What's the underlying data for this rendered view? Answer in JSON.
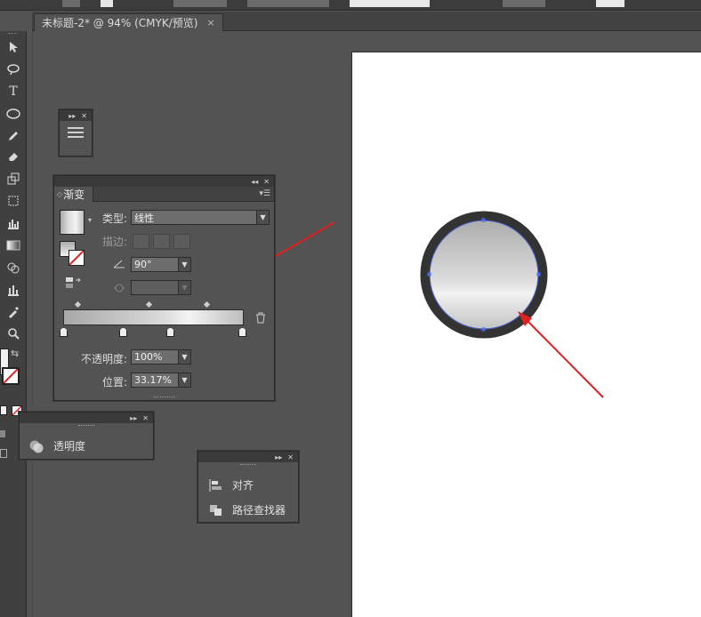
{
  "document_tab": {
    "title": "未标题-2* @ 94% (CMYK/预览)",
    "close": "×"
  },
  "gradient_panel": {
    "tab_label": "渐变",
    "type_label": "类型:",
    "type_value": "线性",
    "stroke_label": "描边:",
    "angle_value": "90°",
    "opacity_label": "不透明度:",
    "opacity_value": "100%",
    "location_label": "位置:",
    "location_value": "33.17%"
  },
  "transparency_panel": {
    "label": "透明度"
  },
  "align_panel": {
    "items": [
      {
        "label": "对齐",
        "icon": "align-icon"
      },
      {
        "label": "路径查找器",
        "icon": "pathfinder-icon"
      }
    ]
  },
  "colors": {
    "accent_arrow": "#e02020",
    "circle_stroke": "#333333",
    "panel_bg": "#535353"
  }
}
